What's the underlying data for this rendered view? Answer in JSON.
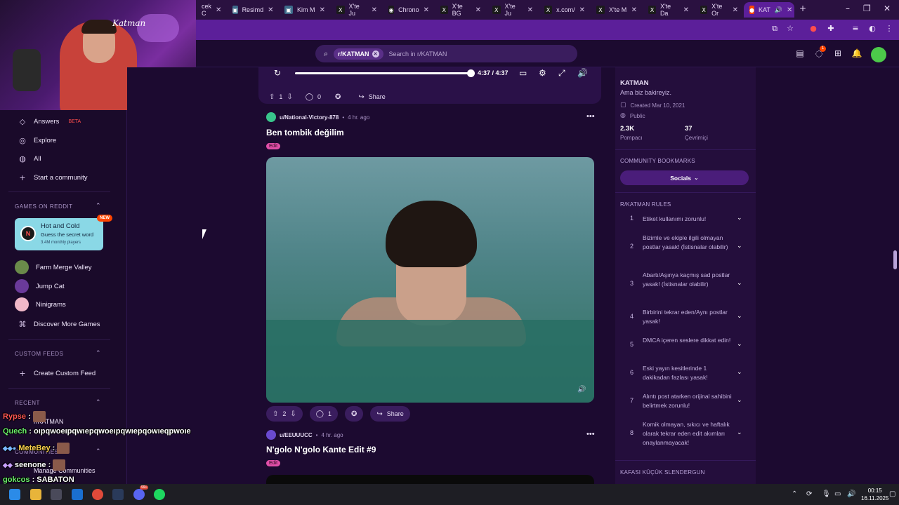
{
  "browser": {
    "tabs": [
      {
        "icon": "reddit-icon",
        "label": "cek C"
      },
      {
        "icon": "image-icon",
        "label": "Resimd"
      },
      {
        "icon": "image-icon",
        "label": "Kim M"
      },
      {
        "icon": "x-icon",
        "label": "X'te Ju"
      },
      {
        "icon": "camera-icon",
        "label": "Chrono"
      },
      {
        "icon": "x-icon",
        "label": "X'te BG"
      },
      {
        "icon": "x-icon",
        "label": "X'te Ju"
      },
      {
        "icon": "x-icon",
        "label": "x.com/"
      },
      {
        "icon": "x-icon",
        "label": "X'te M"
      },
      {
        "icon": "x-icon",
        "label": "X'te Da"
      },
      {
        "icon": "x-icon",
        "label": "X'te Or"
      },
      {
        "icon": "reddit-icon",
        "label": "KAT"
      }
    ],
    "new_tab": "+"
  },
  "header": {
    "search_chip": "r/KATMAN",
    "search_placeholder": "Search in r/KATMAN",
    "notification_count": "1"
  },
  "sidebar": {
    "items": [
      {
        "icon": "answers-icon",
        "label": "Answers",
        "badge": "BETA"
      },
      {
        "icon": "explore-icon",
        "label": "Explore"
      },
      {
        "icon": "all-icon",
        "label": "All"
      },
      {
        "icon": "plus-icon",
        "label": "Start a community"
      }
    ],
    "games_header": "GAMES ON REDDIT",
    "featured_game": {
      "title": "Hot and Cold",
      "subtitle": "Guess the secret word",
      "players": "3.4M monthly players",
      "badge": "NEW"
    },
    "games": [
      {
        "label": "Farm Merge Valley"
      },
      {
        "label": "Jump Cat"
      },
      {
        "label": "Ninigrams"
      },
      {
        "label": "Discover More Games"
      }
    ],
    "custom_feeds_header": "CUSTOM FEEDS",
    "create_custom_feed": "Create Custom Feed",
    "recent_header": "RECENT",
    "recent_item": "r/KATMAN",
    "communities_header": "COMMUNITIES",
    "manage_communities": "Manage Communities"
  },
  "player": {
    "time": "4:37 / 4:37",
    "progress": 1.0
  },
  "posts": [
    {
      "upvotes": "1",
      "comments": "0",
      "share": "Share"
    },
    {
      "user": "u/National-Victory-878",
      "time": "4 hr. ago",
      "title": "Ben tombik değilim",
      "flair": "Edit",
      "upvotes": "2",
      "comments": "1",
      "share": "Share"
    },
    {
      "user": "u/EEUUUCC",
      "time": "4 hr. ago",
      "title": "N'golo N'golo Kante Edit #9",
      "flair": "Edit"
    }
  ],
  "community": {
    "name": "KATMAN",
    "description": "Ama biz bakireyiz.",
    "created": "Created Mar 10, 2021",
    "visibility": "Public",
    "members_value": "2.3K",
    "members_label": "Pompacı",
    "online_value": "37",
    "online_label": "Çevrimiçi",
    "bookmarks_header": "COMMUNITY BOOKMARKS",
    "socials_label": "Socials",
    "rules_header": "R/KATMAN RULES",
    "rules": [
      {
        "num": "1",
        "text": "Etiket kullanımı zorunlu!"
      },
      {
        "num": "2",
        "text": "Bizimle ve ekiple ilgili olmayan postlar yasak! (İstisnalar olabilir)"
      },
      {
        "num": "3",
        "text": "Abartı/Aşınya kaçmış sad postlar yasak! (İstisnalar olabilir)"
      },
      {
        "num": "4",
        "text": "Birbirini tekrar eden/Aynı postlar yasak!"
      },
      {
        "num": "5",
        "text": "DMCA içeren seslere dikkat edin!"
      },
      {
        "num": "6",
        "text": "Eski yayın kesitlerinde 1 dakikadan fazlası yasak!"
      },
      {
        "num": "7",
        "text": "Alıntı post atarken orijinal sahibini belirtmek zorunlu!"
      },
      {
        "num": "8",
        "text": "Komik olmayan, sıkıcı ve haftalık olarak tekrar eden edit akımları onaylanmayacak!"
      }
    ],
    "footer_header": "KAFASI KÜÇÜK SLENDERGUN"
  },
  "chat": [
    {
      "name": "Rypse",
      "message": ":"
    },
    {
      "name": "Quech",
      "message": ": oıpqwoeıpqwıepqwoeıpqwıepqowıeqpwoıe"
    },
    {
      "name": "MeteBey",
      "message": ":"
    },
    {
      "name": "seenone",
      "message": ":"
    },
    {
      "name": "gokcos",
      "message": ": SABATON"
    }
  ],
  "taskbar": {
    "time": "00:15",
    "date": "16.11.2025",
    "discord_badge": "99+"
  },
  "colors": {
    "accent": "#5c1f9a",
    "reddit_bg": "#1c0a30",
    "beta": "#ff4d4d",
    "new_badge": "#ff4500"
  }
}
